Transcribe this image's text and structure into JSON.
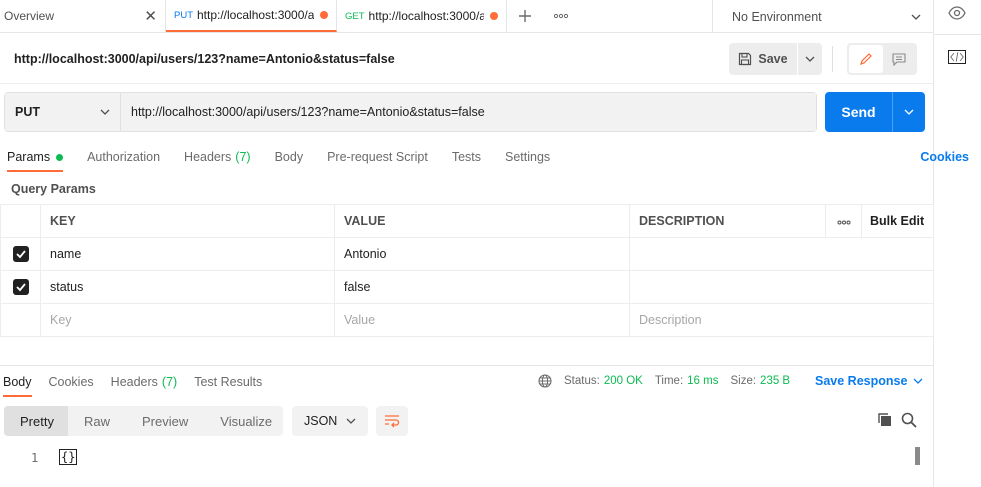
{
  "tabs": [
    {
      "label": "Overview"
    },
    {
      "method": "PUT",
      "url": "http://localhost:3000/a"
    },
    {
      "method": "GET",
      "url": "http://localhost:3000/a"
    }
  ],
  "environment": "No Environment",
  "request": {
    "title": "http://localhost:3000/api/users/123?name=Antonio&status=false",
    "method": "PUT",
    "url": "http://localhost:3000/api/users/123?name=Antonio&status=false",
    "save_label": "Save",
    "send_label": "Send"
  },
  "request_tabs": [
    {
      "label": "Params"
    },
    {
      "label": "Authorization"
    },
    {
      "label": "Headers",
      "count": "(7)"
    },
    {
      "label": "Body"
    },
    {
      "label": "Pre-request Script"
    },
    {
      "label": "Tests"
    },
    {
      "label": "Settings"
    }
  ],
  "cookies_label": "Cookies",
  "query_params": {
    "title": "Query Params",
    "headers": {
      "key": "KEY",
      "value": "VALUE",
      "description": "DESCRIPTION",
      "bulk_edit": "Bulk Edit"
    },
    "rows": [
      {
        "key": "name",
        "value": "Antonio",
        "description": ""
      },
      {
        "key": "status",
        "value": "false",
        "description": ""
      }
    ],
    "placeholders": {
      "key": "Key",
      "value": "Value",
      "description": "Description"
    }
  },
  "response": {
    "tabs": [
      {
        "label": "Body"
      },
      {
        "label": "Cookies"
      },
      {
        "label": "Headers",
        "count": "(7)"
      },
      {
        "label": "Test Results"
      }
    ],
    "status_label": "Status:",
    "status_value": "200 OK",
    "time_label": "Time:",
    "time_value": "16 ms",
    "size_label": "Size:",
    "size_value": "235 B",
    "save_response_label": "Save Response",
    "views": [
      "Pretty",
      "Raw",
      "Preview",
      "Visualize"
    ],
    "format": "JSON",
    "line_number": "1",
    "body": "{}"
  },
  "colors": {
    "accent": "#ff6c37",
    "primary": "#097bed",
    "success": "#0cbb52"
  }
}
